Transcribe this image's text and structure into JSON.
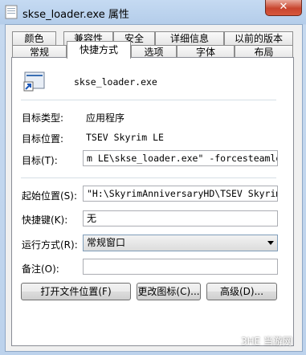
{
  "window": {
    "title": "skse_loader.exe 属性",
    "close_label": "✕"
  },
  "tabs_row1": [
    "颜色",
    "兼容性",
    "安全",
    "详细信息",
    "以前的版本"
  ],
  "tabs_row2": [
    "常规",
    "快捷方式",
    "选项",
    "字体",
    "布局"
  ],
  "selected_tab": "快捷方式",
  "shortcut": {
    "name": "skse_loader.exe",
    "target_type_label": "目标类型:",
    "target_type": "应用程序",
    "target_location_label": "目标位置:",
    "target_location": "TSEV Skyrim LE",
    "target_label": "目标(T):",
    "target_value": "m LE\\skse_loader.exe\" -forcesteamloader",
    "start_in_label": "起始位置(S):",
    "start_in_value": "\"H:\\SkyrimAnniversaryHD\\TSEV Skyrim LE\"",
    "hotkey_label": "快捷键(K):",
    "hotkey_value": "无",
    "run_label": "运行方式(R):",
    "run_value": "常规窗口",
    "comment_label": "备注(O):",
    "comment_value": ""
  },
  "buttons": {
    "open_location": "打开文件位置(F)",
    "change_icon": "更改图标(C)...",
    "advanced": "高级(D)..."
  },
  "watermark": "3HE 当游网"
}
